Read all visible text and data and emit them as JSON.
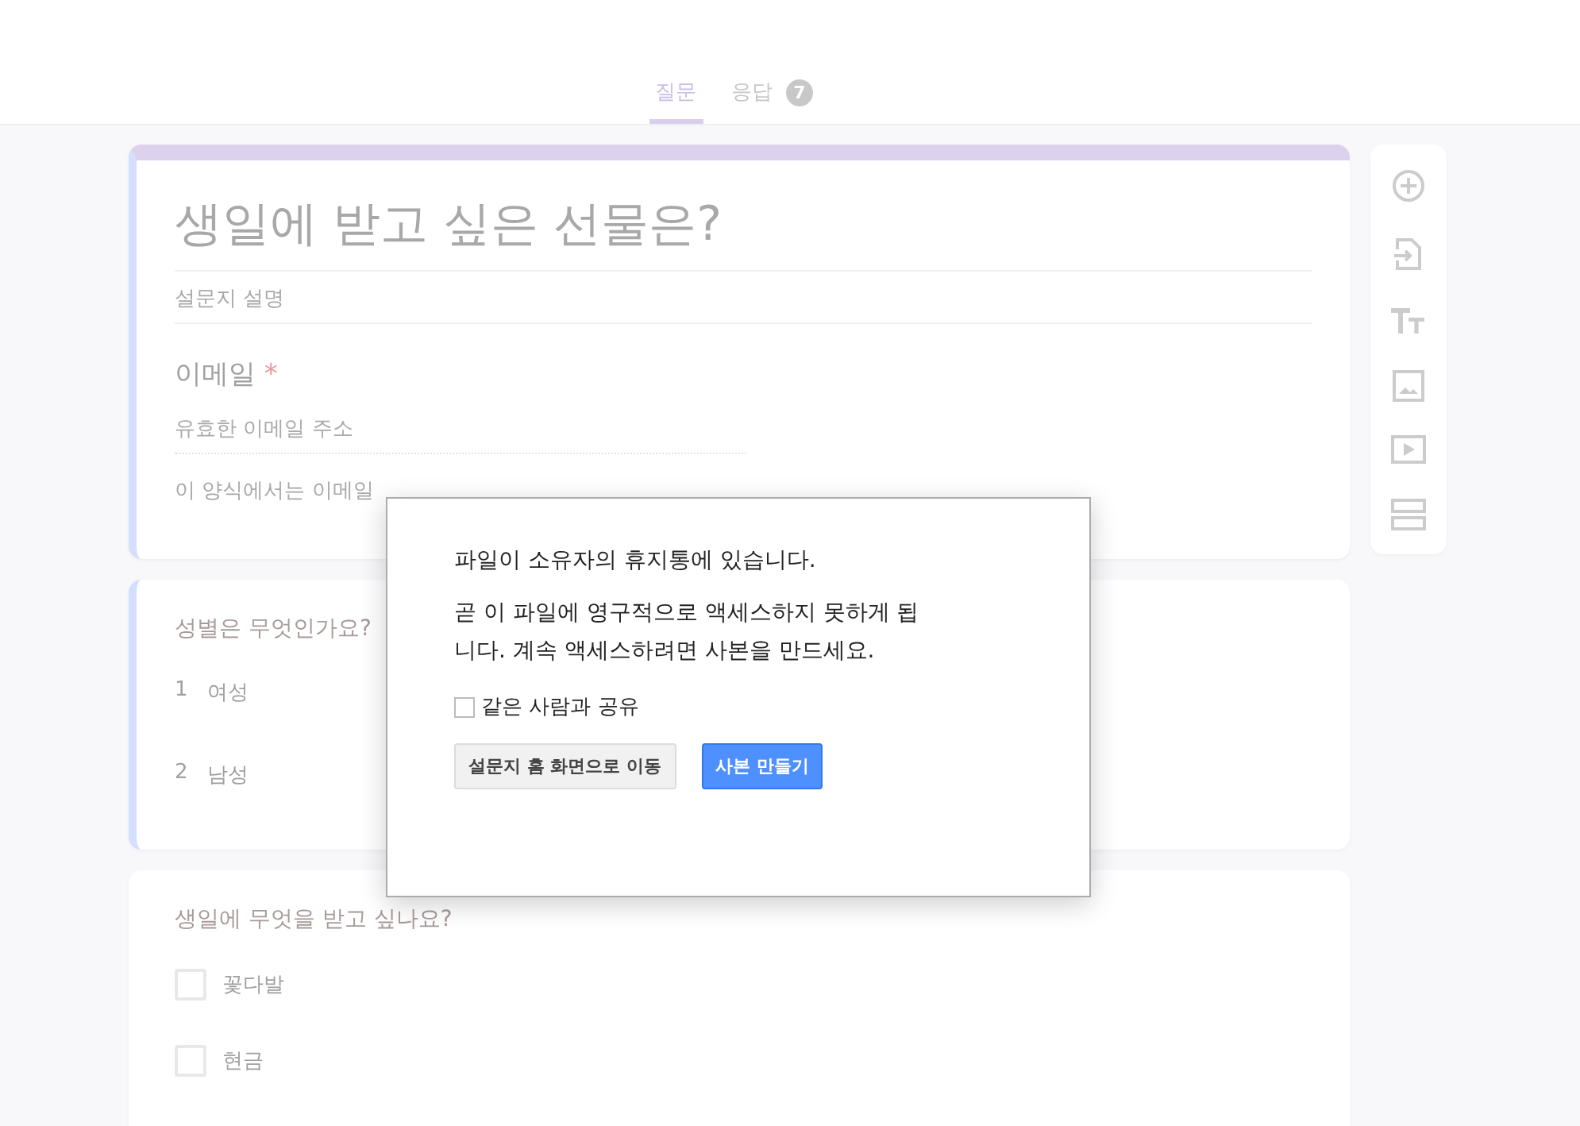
{
  "tabs": [
    {
      "label": "질문",
      "selected": true
    },
    {
      "label": "응답",
      "selected": false,
      "badge": "7"
    }
  ],
  "form": {
    "title": "생일에 받고 싶은 선물은?",
    "description_placeholder": "설문지 설명",
    "email": {
      "label": "이메일",
      "required_mark": "*",
      "placeholder": "유효한 이메일 주소",
      "notice": "이 양식에서는 이메일"
    },
    "questions": [
      {
        "kind": "dropdown",
        "title": "성별은 무엇인가요?",
        "highlighted": true,
        "options": [
          {
            "number": "1",
            "label": "여성"
          },
          {
            "number": "2",
            "label": "남성"
          }
        ]
      },
      {
        "kind": "checkbox",
        "title": "생일에 무엇을 받고 싶나요?",
        "highlighted": false,
        "options": [
          {
            "label": "꽃다발",
            "checked": false
          },
          {
            "label": "현금",
            "checked": false
          }
        ]
      }
    ]
  },
  "dialog": {
    "title": "파일이 소유자의 휴지통에 있습니다.",
    "message": "곧 이 파일에 영구적으로 액세스하지 못하게 됩니다. 계속 액세스하려면 사본을 만드세요.",
    "share_checkbox": {
      "label": "같은 사람과 공유",
      "checked": false
    },
    "buttons": [
      {
        "label": "설문지 홈 화면으로 이동",
        "kind": "secondary"
      },
      {
        "label": "사본 만들기",
        "kind": "primary"
      }
    ]
  }
}
